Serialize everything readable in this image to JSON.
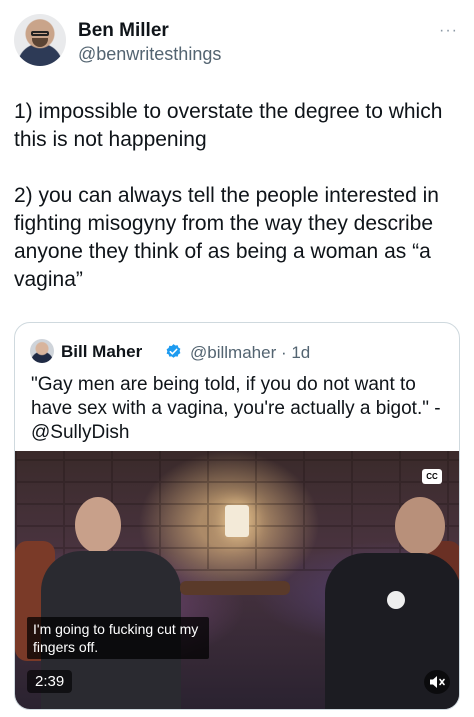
{
  "author": {
    "display_name": "Ben Miller",
    "handle": "@benwritesthings",
    "more_icon": "···"
  },
  "tweet": {
    "text": "1) impossible to overstate the degree to which this is not happening\n\n2) you can always tell the people interested in fighting misogyny from the way they describe anyone they think of as being a woman as “a vagina”"
  },
  "quoted": {
    "display_name": "Bill Maher",
    "verified_color": "#1d9bf0",
    "handle_time": "@billmaher · 1d",
    "text": "\"Gay men are being told, if you do not want to have sex with a vagina, you're actually a bigot.\" - @SullyDish",
    "video": {
      "cc_label": "CC",
      "caption": "I'm going to fucking cut my fingers off.",
      "duration": "2:39"
    }
  }
}
